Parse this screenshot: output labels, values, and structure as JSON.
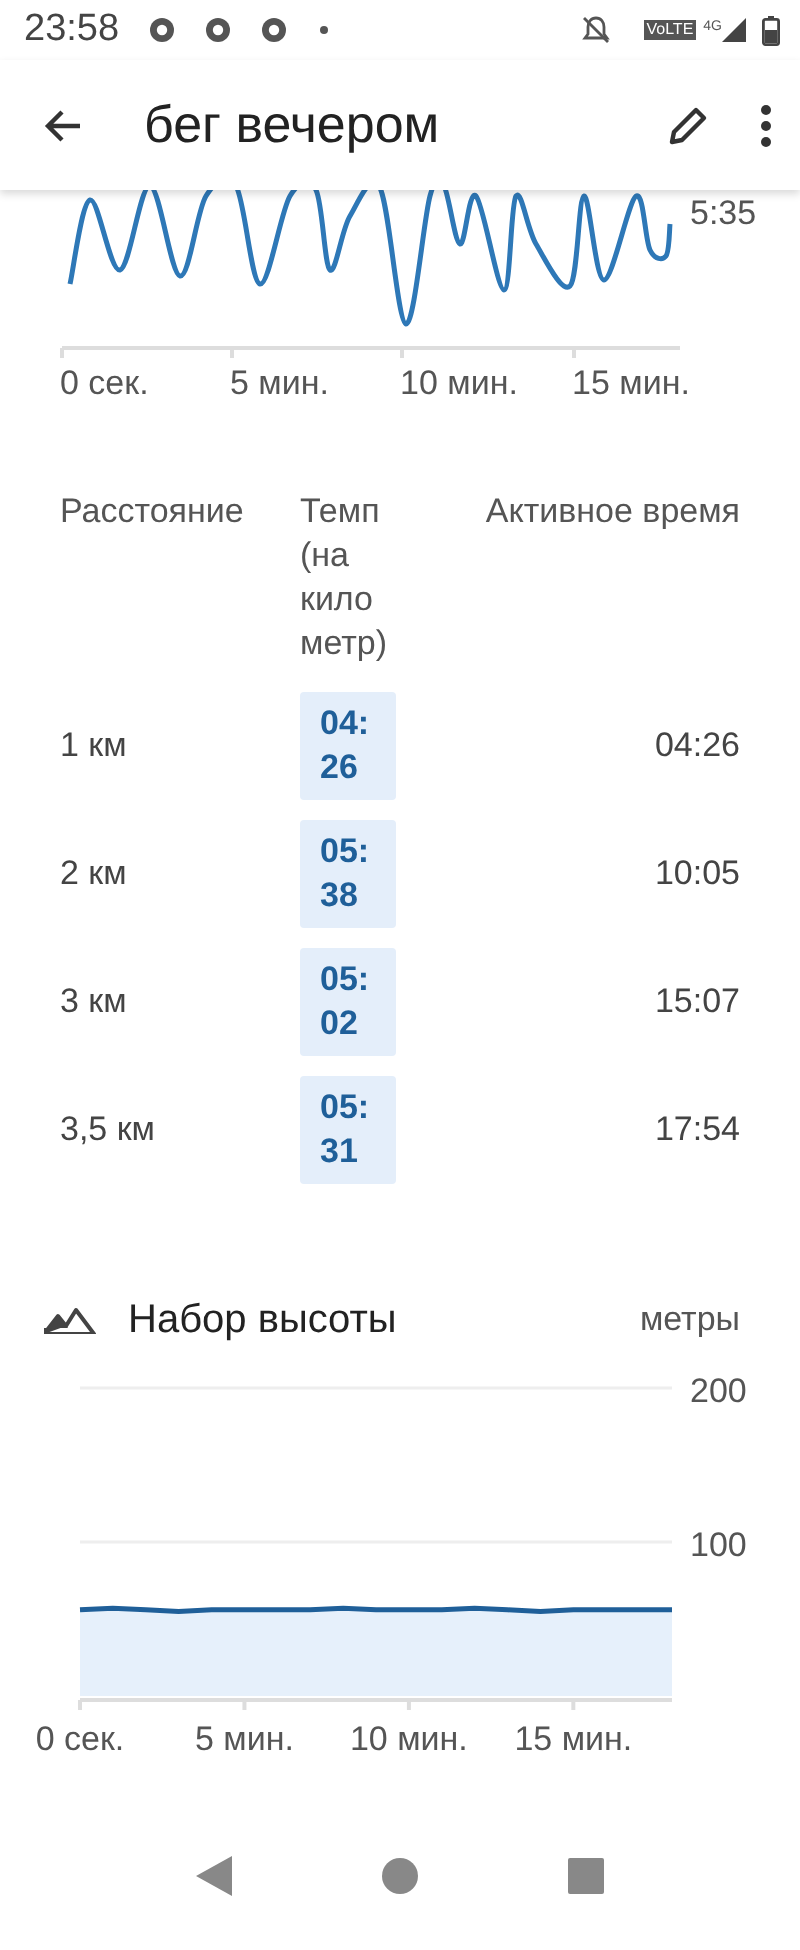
{
  "status_bar": {
    "time": "23:58",
    "network": "VoLTE",
    "network_type": "4G"
  },
  "app_bar": {
    "title": "бег вечером"
  },
  "pace_chart": {
    "y_tick": "5:35",
    "x_labels": [
      "0 сек.",
      "5 мин.",
      "10 мин.",
      "15 мин."
    ]
  },
  "splits": {
    "columns": [
      "Расстояние",
      "Темп (на кило метр)",
      "Активное время"
    ],
    "rows": [
      {
        "distance": "1 км",
        "pace": "04:26",
        "active_time": "04:26"
      },
      {
        "distance": "2 км",
        "pace": "05:38",
        "active_time": "10:05"
      },
      {
        "distance": "3 км",
        "pace": "05:02",
        "active_time": "15:07"
      },
      {
        "distance": "3,5 км",
        "pace": "05:31",
        "active_time": "17:54"
      }
    ]
  },
  "elevation": {
    "chart_data": {
      "type": "area",
      "title": "Набор высоты",
      "ylabel": "метры",
      "x": [
        0,
        1,
        2,
        3,
        4,
        5,
        6,
        7,
        8,
        9,
        10,
        11,
        12,
        13,
        14,
        15,
        16,
        17,
        18
      ],
      "series": [
        {
          "color": "#1f5f99",
          "values": [
            56,
            57,
            56,
            55,
            56,
            56,
            56,
            56,
            57,
            56,
            56,
            56,
            57,
            56,
            55,
            56,
            56,
            56,
            56
          ]
        }
      ],
      "xlim": [
        0,
        18
      ],
      "ylim": [
        0,
        200
      ],
      "xticks": [
        {
          "value": 0,
          "label": "0 сек."
        },
        {
          "value": 5,
          "label": "5 мин."
        },
        {
          "value": 10,
          "label": "10 мин."
        },
        {
          "value": 15,
          "label": "15 мин."
        }
      ],
      "yticks": [
        100,
        200
      ]
    }
  }
}
